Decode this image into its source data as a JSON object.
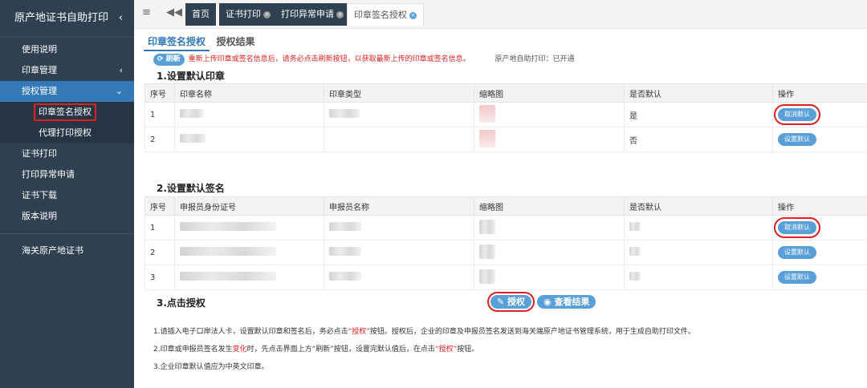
{
  "sidebar": {
    "title": "原产地证书自助打印",
    "items": [
      {
        "label": "使用说明"
      },
      {
        "label": "印章管理"
      },
      {
        "label": "授权管理"
      },
      {
        "label": "印章签名授权"
      },
      {
        "label": "代理打印授权"
      },
      {
        "label": "证书打印"
      },
      {
        "label": "打印异常申请"
      },
      {
        "label": "证书下载"
      },
      {
        "label": "版本说明"
      },
      {
        "label": "海关原产地证书"
      }
    ]
  },
  "tabs": [
    "首页",
    "证书打印",
    "打印异常申请",
    "印章签名授权"
  ],
  "subtabs": [
    "印章签名授权",
    "授权结果"
  ],
  "notice": {
    "refresh_label": "刷新",
    "text": "重新上传印章或签名信息后，请务必点击刷新按钮，以获取最新上传的印章或签名信息。",
    "status": "原产地自助打印：已开通"
  },
  "section1": {
    "title": "1.设置默认印章",
    "headers": [
      "序号",
      "印章名称",
      "印章类型",
      "缩略图",
      "是否默认",
      "操作"
    ],
    "rows": [
      {
        "no": "1",
        "default": "是",
        "action": "取消默认"
      },
      {
        "no": "2",
        "default": "否",
        "action": "设置默认"
      }
    ]
  },
  "section2": {
    "title": "2.设置默认签名",
    "headers": [
      "序号",
      "申报员身份证号",
      "申报员名称",
      "缩略图",
      "是否默认",
      "操作"
    ],
    "rows": [
      {
        "no": "1",
        "action": "取消默认"
      },
      {
        "no": "2",
        "action": "设置默认"
      },
      {
        "no": "3",
        "action": "设置默认"
      }
    ]
  },
  "section3": {
    "title": "3.点击授权",
    "auth_label": "授权",
    "view_label": "查看结果"
  },
  "tips": {
    "t1_a": "1.请插入电子口岸法人卡，设置默认印章和签名后，务必点击",
    "t1_b": "“授权”",
    "t1_c": "按钮。授权后，企业的印章及申报员签名发送到海关端原产地证书管理系统，用于生成自助打印文件。",
    "t2_a": "2.印章或申报员签名发生",
    "t2_b": "变化",
    "t2_c": "时，先点击界面上方“刷新”按钮，设置完默认值后，在点击",
    "t2_d": "“授权”",
    "t2_e": "按钮。",
    "t3": "3.企业印章默认值应为中英文印章。"
  }
}
